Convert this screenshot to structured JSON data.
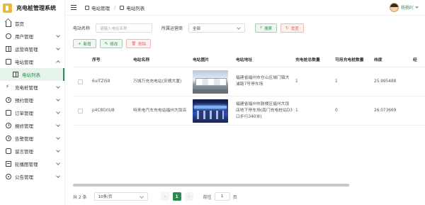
{
  "app": {
    "title": "充电桩管理系统"
  },
  "sidebar": {
    "items": [
      {
        "label": "首页",
        "icon": "home-icon"
      },
      {
        "label": "用户管理",
        "icon": "user-icon"
      },
      {
        "label": "运营商管理",
        "icon": "grid-icon"
      },
      {
        "label": "电站管理",
        "icon": "station-icon",
        "expanded": true
      },
      {
        "label": "电站列表",
        "icon": "list-icon",
        "active": true,
        "sub": true
      },
      {
        "label": "充电桩管理",
        "icon": "bolt-icon"
      },
      {
        "label": "预约管理",
        "icon": "clock-icon"
      },
      {
        "label": "订单管理",
        "icon": "doc-icon"
      },
      {
        "label": "报修管理",
        "icon": "wrench-icon"
      },
      {
        "label": "告警管理",
        "icon": "bell-icon"
      },
      {
        "label": "留言管理",
        "icon": "message-icon"
      },
      {
        "label": "轮播图管理",
        "icon": "image-icon"
      },
      {
        "label": "公告管理",
        "icon": "speaker-icon"
      }
    ]
  },
  "header": {
    "breadcrumb": [
      "电站管理",
      "电站列表"
    ],
    "username": "杨杨吖"
  },
  "filter": {
    "name_label": "电站名称",
    "name_placeholder": "请输入电站名称",
    "operator_label": "所属运营商",
    "operator_value": "全部",
    "search_label": "搜索",
    "reset_label": "重置"
  },
  "actions": {
    "add": "新增",
    "edit": "修改",
    "delete": "删除"
  },
  "table": {
    "headers": [
      "序号",
      "电站名称",
      "电站图片",
      "电站地址",
      "充电桩总数量",
      "可用充电桩数量",
      "纬度",
      "经"
    ],
    "rows": [
      {
        "no": "6uiTZi58",
        "name": "万城万充充电站(安德大厦)",
        "address": "福建省福州市仓山区城门镇大浦路7号停车场",
        "total": "1",
        "available": "1",
        "latitude": "25.995488"
      },
      {
        "no": "p4C8GriU8",
        "name": "特来电汽车充电站福州大饭店",
        "address": "福建省福州市鼓楼区福州大饭店地下停车场(南门充电桩站D3口步行340米)",
        "total": "1",
        "available": "0",
        "latitude": "26.073669"
      }
    ]
  },
  "pagination": {
    "total": "共 2 条",
    "page_size": "10条/页",
    "current": "1",
    "goto_label": "前往",
    "goto_value": "1",
    "page_unit": "页"
  },
  "colors": {
    "accent": "#2c8a4c",
    "danger": "#e0736b",
    "warning": "#d6973a"
  }
}
